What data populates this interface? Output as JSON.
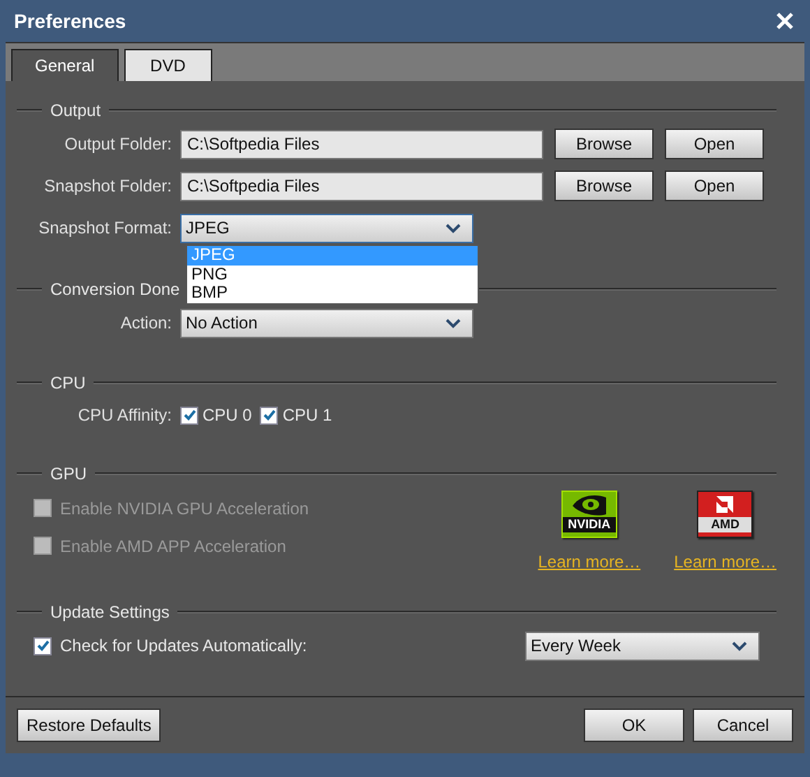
{
  "window": {
    "title": "Preferences"
  },
  "tabs": [
    {
      "label": "General",
      "selected": true
    },
    {
      "label": "DVD",
      "selected": false
    }
  ],
  "output": {
    "heading": "Output",
    "folders": [
      {
        "label": "Output Folder:",
        "value": "C:\\Softpedia Files",
        "buttons": [
          "Browse",
          "Open"
        ]
      },
      {
        "label": "Snapshot Folder:",
        "value": "C:\\Softpedia Files",
        "buttons": [
          "Browse",
          "Open"
        ]
      }
    ],
    "snapshot_format": {
      "label": "Snapshot Format:",
      "value": "JPEG",
      "expanded": true,
      "options": [
        {
          "label": "JPEG",
          "selected": true
        },
        {
          "label": "PNG",
          "selected": false
        },
        {
          "label": "BMP",
          "selected": false
        }
      ]
    }
  },
  "conversion_done": {
    "heading": "Conversion Done",
    "action": {
      "label": "Action:",
      "value": "No Action"
    }
  },
  "cpu": {
    "heading": "CPU",
    "label": "CPU Affinity:",
    "cores": [
      {
        "label": "CPU 0",
        "checked": true
      },
      {
        "label": "CPU 1",
        "checked": true
      }
    ]
  },
  "gpu": {
    "heading": "GPU",
    "options": [
      {
        "label": "Enable NVIDIA GPU Acceleration",
        "checked": false,
        "disabled": true
      },
      {
        "label": "Enable AMD APP Acceleration",
        "checked": false,
        "disabled": true
      }
    ],
    "vendors": [
      {
        "kind": "nvidia",
        "logo_text": "NVIDIA",
        "link": "Learn more…"
      },
      {
        "kind": "amd",
        "logo_text": "AMD",
        "link": "Learn more…"
      }
    ]
  },
  "update_settings": {
    "heading": "Update Settings",
    "check": {
      "label": "Check for Updates Automatically:",
      "checked": true
    },
    "frequency": "Every Week"
  },
  "footer": {
    "left_buttons": [
      "Restore Defaults"
    ],
    "right_buttons": [
      "OK",
      "Cancel"
    ]
  }
}
